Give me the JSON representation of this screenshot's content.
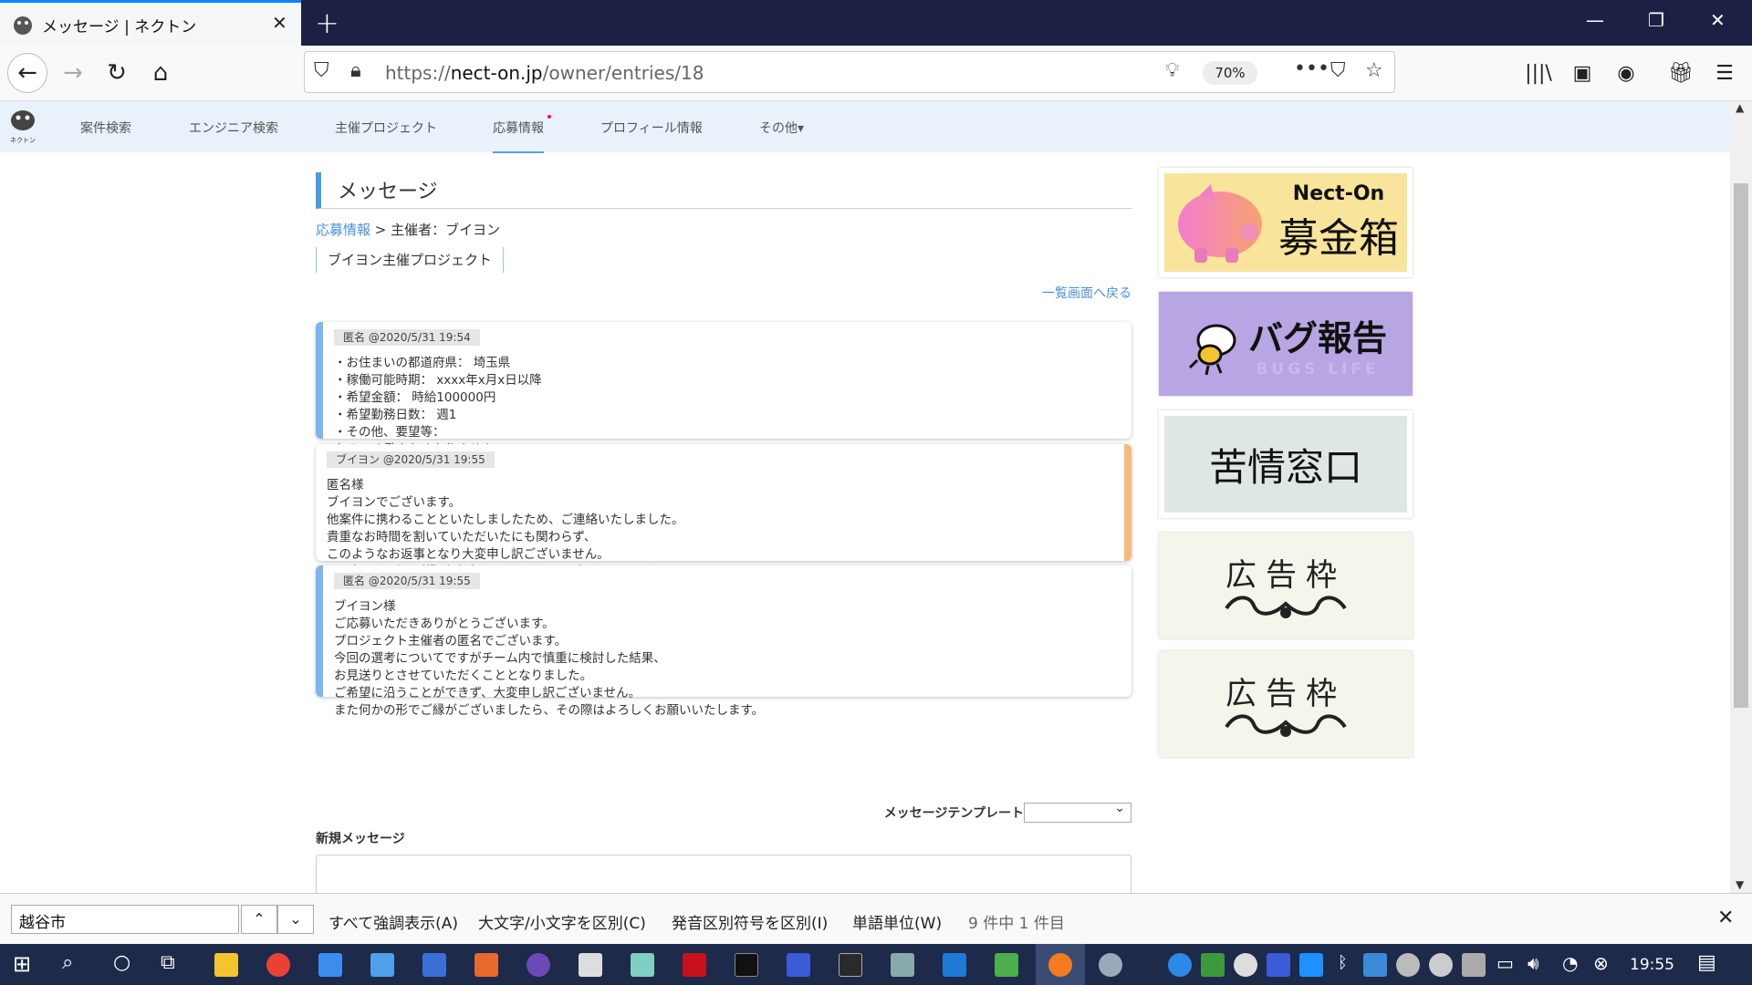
{
  "browser": {
    "tab_title": "メッセージ | ネクトン",
    "url_scheme": "https://",
    "url_host": "nect-on.jp",
    "url_path": "/owner/entries/18",
    "zoom": "70%"
  },
  "site_nav": {
    "logo_text": "ネクトン",
    "items": [
      {
        "label": "案件検索"
      },
      {
        "label": "エンジニア検索"
      },
      {
        "label": "主催プロジェクト"
      },
      {
        "label": "応募情報"
      },
      {
        "label": "プロフィール情報"
      },
      {
        "label": "その他▾"
      }
    ]
  },
  "page": {
    "title": "メッセージ",
    "breadcrumb_link": "応募情報",
    "breadcrumb_rest": " > 主催者：ブイヨン",
    "project_name": "ブイヨン主催プロジェクト",
    "back_link": "一覧画面へ戻る"
  },
  "messages": [
    {
      "header": "匿名 @2020/5/31 19:54",
      "body": "・お住まいの都道府県： 埼玉県\n・稼働可能時期： xxxx年x月x日以降\n・希望金額： 時給100000円\n・希望勤務日数： 週1\n・その他、要望等：\nなるべく働きたくありません。"
    },
    {
      "header": "ブイヨン @2020/5/31 19:55",
      "body": "匿名様\nブイヨンでございます。\n他案件に携わることといたしましたため、ご連絡いたしました。\n貴重なお時間を割いていただいたにも関わらず、\nこのようなお返事となり大変申し訳ございません。\nまた何かの形でご縁がございましたら、その際はよろしくお願いいたします。"
    },
    {
      "header": "匿名 @2020/5/31 19:55",
      "body": "ブイヨン様\nご応募いただきありがとうございます。\nプロジェクト主催者の匿名でございます。\n今回の選考についてですがチーム内で慎重に検討した結果、\nお見送りとさせていただくこととなりました。\nご希望に沿うことができず、大変申し訳ございません。\nまた何かの形でご縁がございましたら、その際はよろしくお願いいたします。"
    }
  ],
  "form": {
    "template_label": "メッセージテンプレート",
    "template_value": "",
    "new_message_label": "新規メッセージ"
  },
  "banners": {
    "b1_top": "Nect-On",
    "b1_main": "募金箱",
    "b2_main": "バグ報告",
    "b2_sub": "BUGS LIFE",
    "b3_main": "苦情窓口",
    "b4_main": "広告枠",
    "b5_main": "広告枠"
  },
  "findbar": {
    "query": "越谷市",
    "highlight_all": "すべて強調表示(A)",
    "match_case": "大文字/小文字を区別(C)",
    "match_diacritics": "発音区別符号を区別(I)",
    "whole_words": "単語単位(W)",
    "count": "9 件中 1 件目"
  },
  "taskbar": {
    "time": "19:55"
  }
}
